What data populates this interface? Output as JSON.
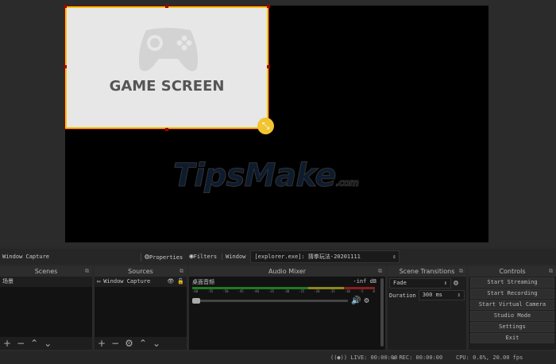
{
  "preview": {
    "game_title": "GAME SCREEN",
    "watermark": "TipsMake",
    "watermark_suffix": ".com"
  },
  "toolbar": {
    "source_name": "Window Capture",
    "properties": "Properties",
    "filters": "Filters",
    "window_label": "Window",
    "window_value": "[explorer.exe]: 猜拳玩法-20201111"
  },
  "scenes": {
    "title": "Scenes",
    "items": [
      "场景"
    ]
  },
  "sources": {
    "title": "Sources",
    "items": [
      "Window Capture"
    ]
  },
  "mixer": {
    "title": "Audio Mixer",
    "channel": "桌面音频",
    "level": "-inf dB",
    "ticks": [
      "-60",
      "-55",
      "-50",
      "-45",
      "-40",
      "-35",
      "-30",
      "-25",
      "-20",
      "-15",
      "-10",
      "-5",
      "0"
    ],
    "volume_percent": 0
  },
  "transitions": {
    "title": "Scene Transitions",
    "selected": "Fade",
    "duration_label": "Duration",
    "duration_value": "300 ms"
  },
  "controls": {
    "title": "Controls",
    "buttons": [
      "Start Streaming",
      "Start Recording",
      "Start Virtual Camera",
      "Studio Mode",
      "Settings",
      "Exit"
    ]
  },
  "status": {
    "live": "LIVE: 00:00:00",
    "rec": "REC: 00:00:00",
    "cpu": "CPU: 0.6%, 20.00 fps"
  },
  "colors": {
    "selection": "#f1c40f",
    "meter_green": "#1f7a1f",
    "meter_yellow": "#8a8a1a",
    "meter_red": "#8a1f1f"
  }
}
